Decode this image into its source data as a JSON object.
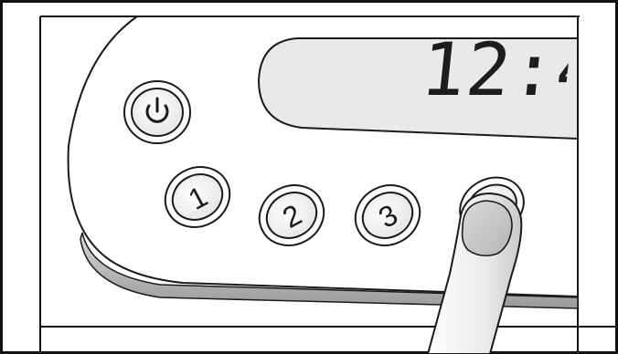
{
  "display": {
    "time_text": "12:4"
  },
  "buttons": {
    "power": {
      "icon": "power-icon"
    },
    "program_1": {
      "label": "1"
    },
    "program_2": {
      "label": "2"
    },
    "program_3": {
      "label": "3"
    },
    "program_4": {
      "label": ""
    }
  },
  "colors": {
    "panel": "#ffffff",
    "panel_shadow": "#b7b7b7",
    "lcd_fill": "#e9e9e9",
    "outline": "#1a1a1a",
    "finger": "#e8e8e8"
  }
}
